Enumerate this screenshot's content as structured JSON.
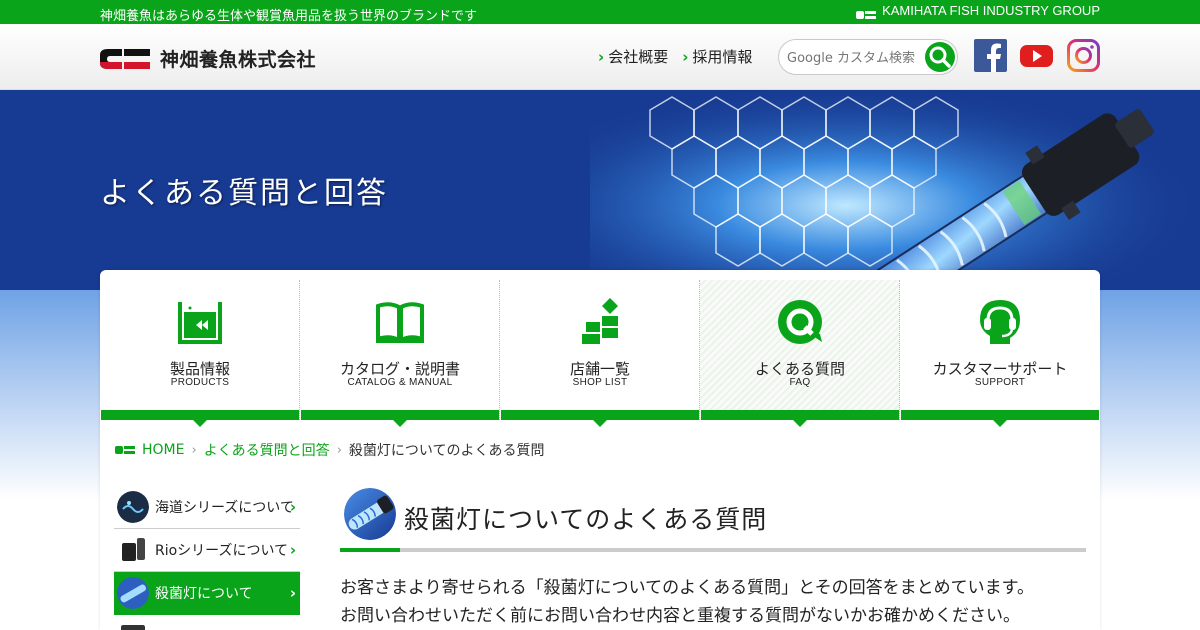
{
  "topbar": {
    "tagline": "神畑養魚はあらゆる生体や観賞魚用品を扱う世界のブランドです",
    "group": "KAMIHATA FISH INDUSTRY GROUP"
  },
  "header": {
    "company_name": "神畑養魚株式会社",
    "nav": [
      {
        "label": "会社概要"
      },
      {
        "label": "採用情報"
      }
    ],
    "search_placeholder": "Google カスタム検索",
    "social": [
      "facebook-icon",
      "youtube-icon",
      "instagram-icon"
    ]
  },
  "hero": {
    "title": "よくある質問と回答"
  },
  "main_nav": [
    {
      "jp": "製品情報",
      "en": "PRODUCTS",
      "icon": "aquarium-icon"
    },
    {
      "jp": "カタログ・説明書",
      "en": "CATALOG & MANUAL",
      "icon": "book-icon"
    },
    {
      "jp": "店舗一覧",
      "en": "SHOP LIST",
      "icon": "map-pin-icon"
    },
    {
      "jp": "よくある質問",
      "en": "FAQ",
      "icon": "faq-icon",
      "active": true
    },
    {
      "jp": "カスタマーサポート",
      "en": "SUPPORT",
      "icon": "headset-icon"
    }
  ],
  "breadcrumb": {
    "home": "HOME",
    "parent": "よくある質問と回答",
    "current": "殺菌灯についてのよくある質問"
  },
  "sidebar": {
    "items": [
      {
        "label": "海道シリーズについて"
      },
      {
        "label": "Rioシリーズについて"
      },
      {
        "label": "殺菌灯について",
        "active": true
      }
    ]
  },
  "content": {
    "title": "殺菌灯についてのよくある質問",
    "lines": [
      "お客さまより寄せられる「殺菌灯についてのよくある質問」とその回答をまとめています。",
      "お問い合わせいただく前にお問い合わせ内容と重複する質問がないかお確かめください。"
    ]
  },
  "colors": {
    "brand_green": "#0aa41a",
    "hero_blue": "#173a92",
    "logo_red": "#d4142a"
  }
}
